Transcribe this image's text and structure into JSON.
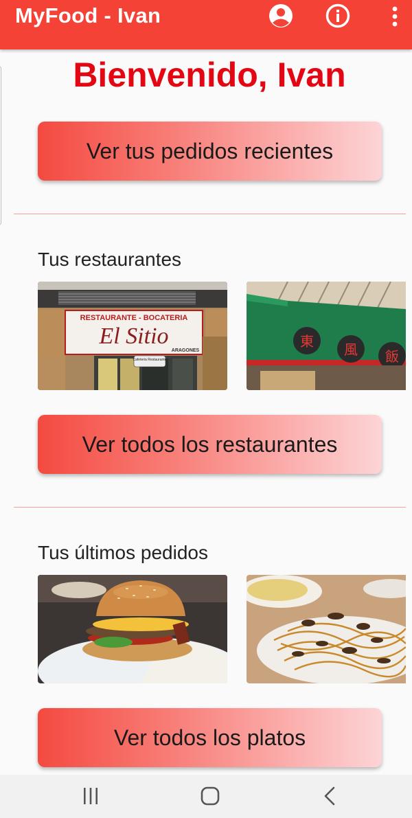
{
  "app_bar": {
    "title": "MyFood - Ivan",
    "icons": [
      "account-icon",
      "info-icon",
      "more-vert-icon"
    ]
  },
  "welcome": "Bienvenido, Ivan",
  "buttons": {
    "recent_orders": "Ver tus pedidos recientes",
    "all_restaurants": "Ver todos los restaurantes",
    "all_dishes": "Ver todos los platos"
  },
  "sections": {
    "restaurants": {
      "title": "Tus restaurantes"
    },
    "orders": {
      "title": "Tus últimos pedidos"
    }
  },
  "images": {
    "restaurant_1": {
      "sign_top": "RESTAURANTE - BOCATERIA",
      "sign_name": "El Sitio",
      "sign_sub": "ARAGONES",
      "door_sign": "Cafeteria Restaurante"
    },
    "restaurant_2": {
      "characters": [
        "東",
        "風",
        "飯"
      ]
    }
  },
  "nav_bar": {
    "icons": [
      "recents-icon",
      "home-icon",
      "back-icon"
    ]
  },
  "colors": {
    "primary": "#f44336",
    "welcome_text": "#e30613",
    "divider": "#f2a19b"
  }
}
